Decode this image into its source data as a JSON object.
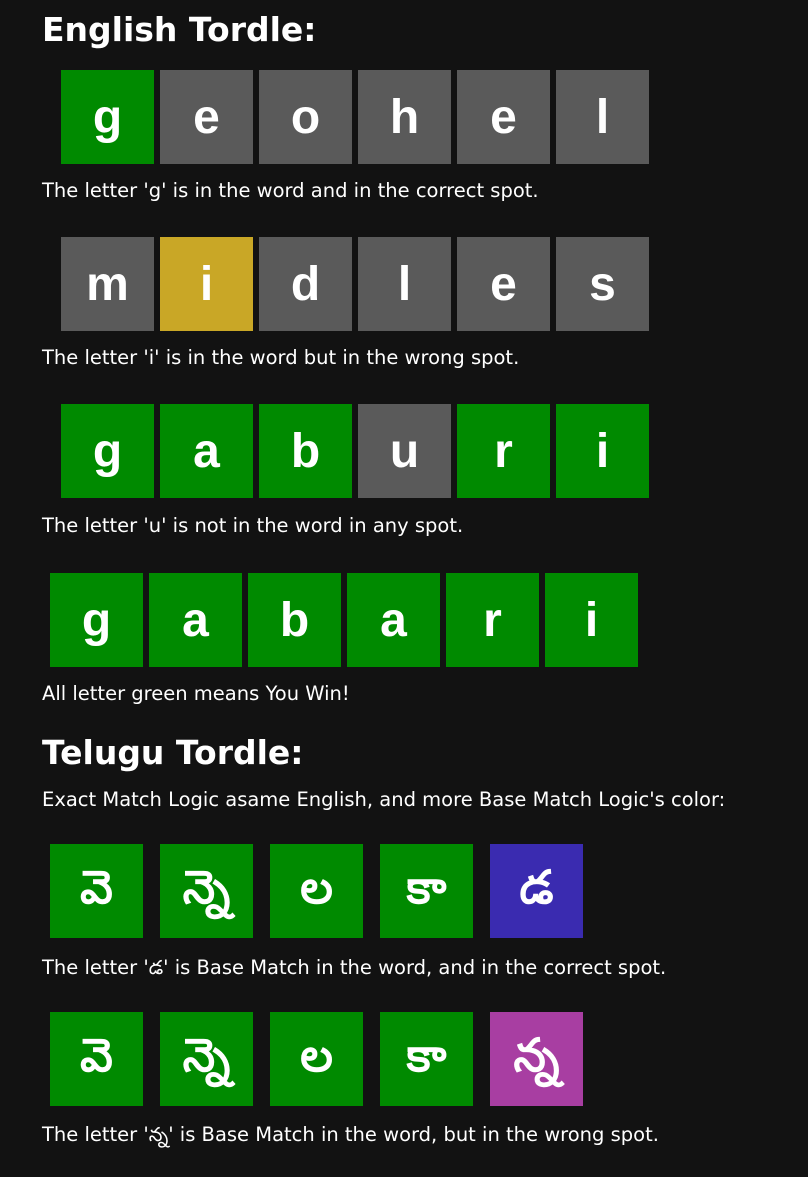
{
  "english": {
    "heading": "English Tordle:",
    "rows": [
      {
        "tiles": [
          {
            "letter": "g",
            "state": "correct"
          },
          {
            "letter": "e",
            "state": "absent"
          },
          {
            "letter": "o",
            "state": "absent"
          },
          {
            "letter": "h",
            "state": "absent"
          },
          {
            "letter": "e",
            "state": "absent"
          },
          {
            "letter": "l",
            "state": "absent"
          }
        ],
        "caption": "The letter 'g' is in the word and in the correct spot."
      },
      {
        "tiles": [
          {
            "letter": "m",
            "state": "absent"
          },
          {
            "letter": "i",
            "state": "present"
          },
          {
            "letter": "d",
            "state": "absent"
          },
          {
            "letter": "l",
            "state": "absent"
          },
          {
            "letter": "e",
            "state": "absent"
          },
          {
            "letter": "s",
            "state": "absent"
          }
        ],
        "caption": "The letter 'i' is in the word but in the wrong spot."
      },
      {
        "tiles": [
          {
            "letter": "g",
            "state": "correct"
          },
          {
            "letter": "a",
            "state": "correct"
          },
          {
            "letter": "b",
            "state": "correct"
          },
          {
            "letter": "u",
            "state": "absent"
          },
          {
            "letter": "r",
            "state": "correct"
          },
          {
            "letter": "i",
            "state": "correct"
          }
        ],
        "caption": "The letter 'u' is not in the word in any spot."
      },
      {
        "tiles": [
          {
            "letter": "g",
            "state": "correct"
          },
          {
            "letter": "a",
            "state": "correct"
          },
          {
            "letter": "b",
            "state": "correct"
          },
          {
            "letter": "a",
            "state": "correct"
          },
          {
            "letter": "r",
            "state": "correct"
          },
          {
            "letter": "i",
            "state": "correct"
          }
        ],
        "caption": "All letter green means You Win!"
      }
    ]
  },
  "telugu": {
    "heading": "Telugu Tordle:",
    "intro": "Exact Match Logic asame English, and more Base Match Logic's color:",
    "rows": [
      {
        "tiles": [
          {
            "letter": "వె",
            "state": "correct"
          },
          {
            "letter": "న్నె",
            "state": "correct"
          },
          {
            "letter": "ల",
            "state": "correct"
          },
          {
            "letter": "కా",
            "state": "correct"
          },
          {
            "letter": "డ",
            "state": "base-correct"
          }
        ],
        "caption": "The letter 'డ' is Base Match in the word, and in the correct spot."
      },
      {
        "tiles": [
          {
            "letter": "వె",
            "state": "correct"
          },
          {
            "letter": "న్నె",
            "state": "correct"
          },
          {
            "letter": "ల",
            "state": "correct"
          },
          {
            "letter": "కా",
            "state": "correct"
          },
          {
            "letter": "న్న",
            "state": "base-present"
          }
        ],
        "caption": "The letter 'న్న' is Base Match in the word, but in the wrong spot."
      }
    ]
  },
  "colors": {
    "correct": "#008a00",
    "absent": "#5a5a5a",
    "present": "#c9a726",
    "base_correct": "#3a2bb0",
    "base_present": "#a83ea2",
    "background": "#121212"
  }
}
